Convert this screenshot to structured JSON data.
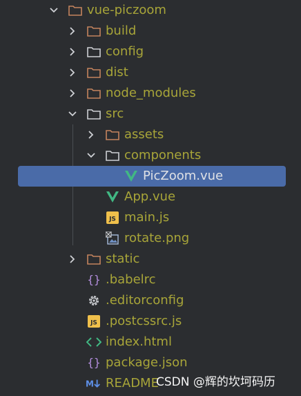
{
  "tree": {
    "items": [
      {
        "label": "vue-piczoom",
        "icon": "folder-brown-icon",
        "chevron": "down"
      },
      {
        "label": "build",
        "icon": "folder-brown-icon",
        "chevron": "right"
      },
      {
        "label": "config",
        "icon": "folder-outline-icon",
        "chevron": "right"
      },
      {
        "label": "dist",
        "icon": "folder-brown-icon",
        "chevron": "right"
      },
      {
        "label": "node_modules",
        "icon": "folder-brown-icon",
        "chevron": "right"
      },
      {
        "label": "src",
        "icon": "folder-outline-icon",
        "chevron": "down"
      },
      {
        "label": "assets",
        "icon": "folder-brown-icon",
        "chevron": "right"
      },
      {
        "label": "components",
        "icon": "folder-outline-icon",
        "chevron": "down"
      },
      {
        "label": "PicZoom.vue",
        "icon": "vue-icon",
        "chevron": ""
      },
      {
        "label": "App.vue",
        "icon": "vue-icon",
        "chevron": ""
      },
      {
        "label": "main.js",
        "icon": "js-file-icon",
        "chevron": ""
      },
      {
        "label": "rotate.png",
        "icon": "image-file-icon",
        "chevron": ""
      },
      {
        "label": "static",
        "icon": "folder-brown-icon",
        "chevron": "right"
      },
      {
        "label": ".babelrc",
        "icon": "braces-icon",
        "chevron": ""
      },
      {
        "label": ".editorconfig",
        "icon": "gear-icon",
        "chevron": ""
      },
      {
        "label": ".postcssrc.js",
        "icon": "js-file-icon",
        "chevron": ""
      },
      {
        "label": "index.html",
        "icon": "html-icon",
        "chevron": ""
      },
      {
        "label": "package.json",
        "icon": "braces-icon",
        "chevron": ""
      },
      {
        "label": "README",
        "icon": "markdown-icon",
        "chevron": ""
      }
    ],
    "selected_label": "PicZoom.vue",
    "colors": {
      "background": "#2b2d30",
      "selection": "#4a6ba8",
      "file_text": "#a8a539",
      "selected_text": "#dfe1e5",
      "folder_brown": "#c5845e",
      "vue_green": "#41b883",
      "js_yellow": "#f0c04b"
    }
  },
  "watermark": {
    "text": "CSDN @辉的坎坷码历"
  }
}
